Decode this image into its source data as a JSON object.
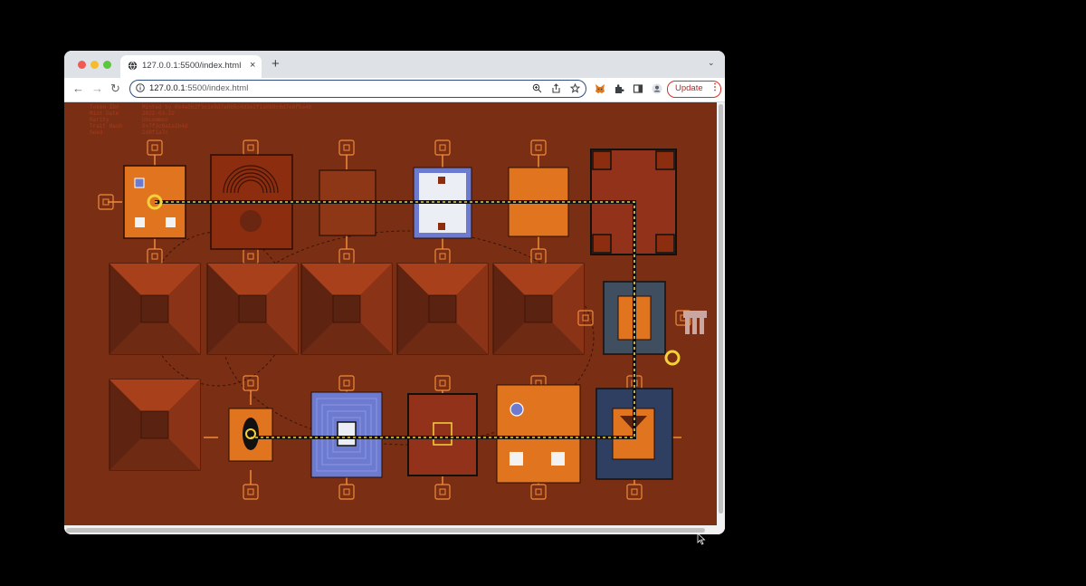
{
  "browser": {
    "tab_title": "127.0.0.1:5500/index.html",
    "new_tab_symbol": "+",
    "tab_close_symbol": "×",
    "tab_menu_symbol": "⌄",
    "url_host": "127.0.0.1",
    "url_path": ":5500/index.html",
    "update_label": "Update",
    "menu_symbol": "⋮",
    "nav": {
      "back": "←",
      "forward": "→",
      "reload": "↻"
    }
  },
  "page": {
    "background": "#7a2f14",
    "metadata": [
      {
        "key": "Token ID#",
        "value": "Minted by 0x4a5b2f3c1e9d7a6b5c4d3e2f1a0b9c8d7e6f5a4b"
      },
      {
        "key": "Mint Date",
        "value": "2022-03-22"
      },
      {
        "key": "Rarity",
        "value": "Uncommon"
      },
      {
        "key": "Trait Hash",
        "value": "0x7f3c9a1e2b4d"
      },
      {
        "key": "Seed",
        "value": "2d8f1a7c"
      }
    ]
  },
  "colors": {
    "orange": "#e0741f",
    "dark_red": "#8c2d10",
    "blue": "#6c7ad0",
    "navy": "#2e3f62",
    "yellow": "#f4d23a",
    "tan": "#f08a3a",
    "pyramid_light": "#a8401c",
    "pyramid_dark": "#5e2411",
    "slate": "#3f4f5f"
  },
  "icons": {
    "globe": "globe-icon",
    "info": "info-icon",
    "zoom": "zoom-icon",
    "share": "share-icon",
    "star": "bookmark-star-icon",
    "fox": "metamask-fox-icon",
    "puzzle": "extensions-puzzle-icon",
    "sidepanel": "side-panel-icon",
    "profile": "profile-avatar-icon"
  }
}
